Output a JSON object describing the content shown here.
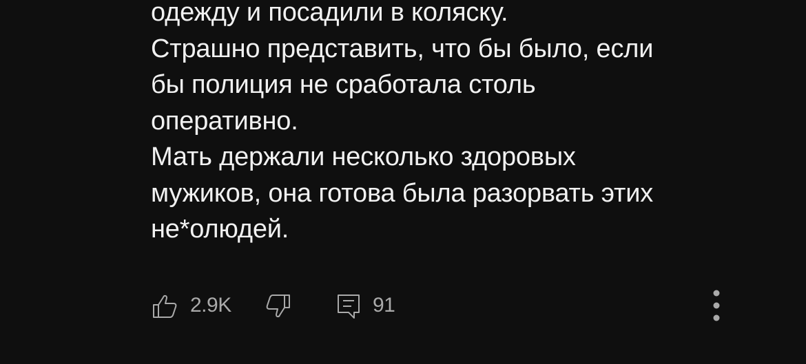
{
  "comment": {
    "lines": [
      "одежду и посадили в коляску.",
      "Страшно представить, что бы было, если",
      "бы полиция не сработала столь",
      "оперативно.",
      "Мать держали несколько здоровых",
      "мужиков, она готова была разорвать этих",
      "не*олюдей."
    ]
  },
  "actions": {
    "like_icon": "thumb-up-icon",
    "like_count": "2.9K",
    "dislike_icon": "thumb-down-icon",
    "reply_icon": "reply-comment-icon",
    "reply_count": "91",
    "more_icon": "more-vertical-icon"
  },
  "colors": {
    "background": "#0f0f0f",
    "text_primary": "#f1f1f1",
    "text_secondary": "#aaaaaa"
  }
}
